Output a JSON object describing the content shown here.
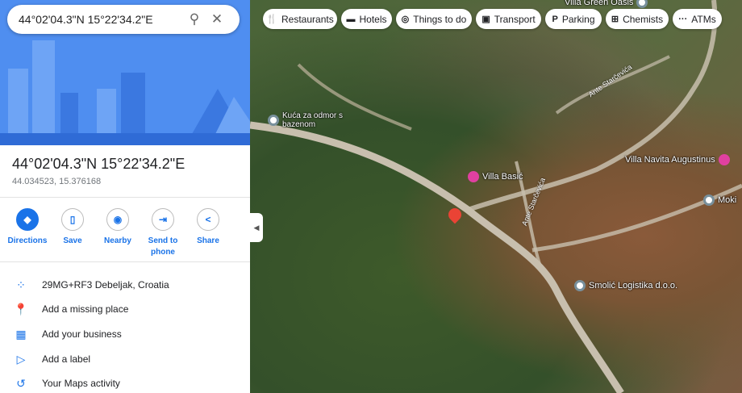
{
  "search": {
    "query": "44°02'04.3\"N 15°22'34.2\"E"
  },
  "place": {
    "title": "44°02'04.3\"N 15°22'34.2\"E",
    "coords": "44.034523, 15.376168"
  },
  "actions": [
    {
      "label": "Directions",
      "icon": "directions-icon"
    },
    {
      "label": "Save",
      "icon": "bookmark-icon"
    },
    {
      "label": "Nearby",
      "icon": "nearby-icon"
    },
    {
      "label": "Send to phone",
      "icon": "send-to-phone-icon"
    },
    {
      "label": "Share",
      "icon": "share-icon"
    }
  ],
  "rows": [
    {
      "label": "29MG+RF3 Debeljak, Croatia",
      "icon": "plus-code-icon"
    },
    {
      "label": "Add a missing place",
      "icon": "add-place-icon"
    },
    {
      "label": "Add your business",
      "icon": "business-icon"
    },
    {
      "label": "Add a label",
      "icon": "label-icon"
    },
    {
      "label": "Your Maps activity",
      "icon": "history-icon"
    }
  ],
  "chips": [
    {
      "label": "Restaurants",
      "icon": "🍴"
    },
    {
      "label": "Hotels",
      "icon": "▬"
    },
    {
      "label": "Things to do",
      "icon": "◎"
    },
    {
      "label": "Transport",
      "icon": "▣"
    },
    {
      "label": "Parking",
      "icon": "P"
    },
    {
      "label": "Chemists",
      "icon": "⊞"
    },
    {
      "label": "ATMs",
      "icon": "···"
    }
  ],
  "map_labels": {
    "green_oasis": "Villa Green Oasis",
    "kuca": "Kuća za odmor s bazenom",
    "basic": "Villa Basić",
    "navita": "Villa Navita Augustinus",
    "moki": "Moki",
    "smolic": "Smolić Logistika d.o.o.",
    "road1": "Ante Starčevića",
    "road2": "Ante Starčevića"
  }
}
